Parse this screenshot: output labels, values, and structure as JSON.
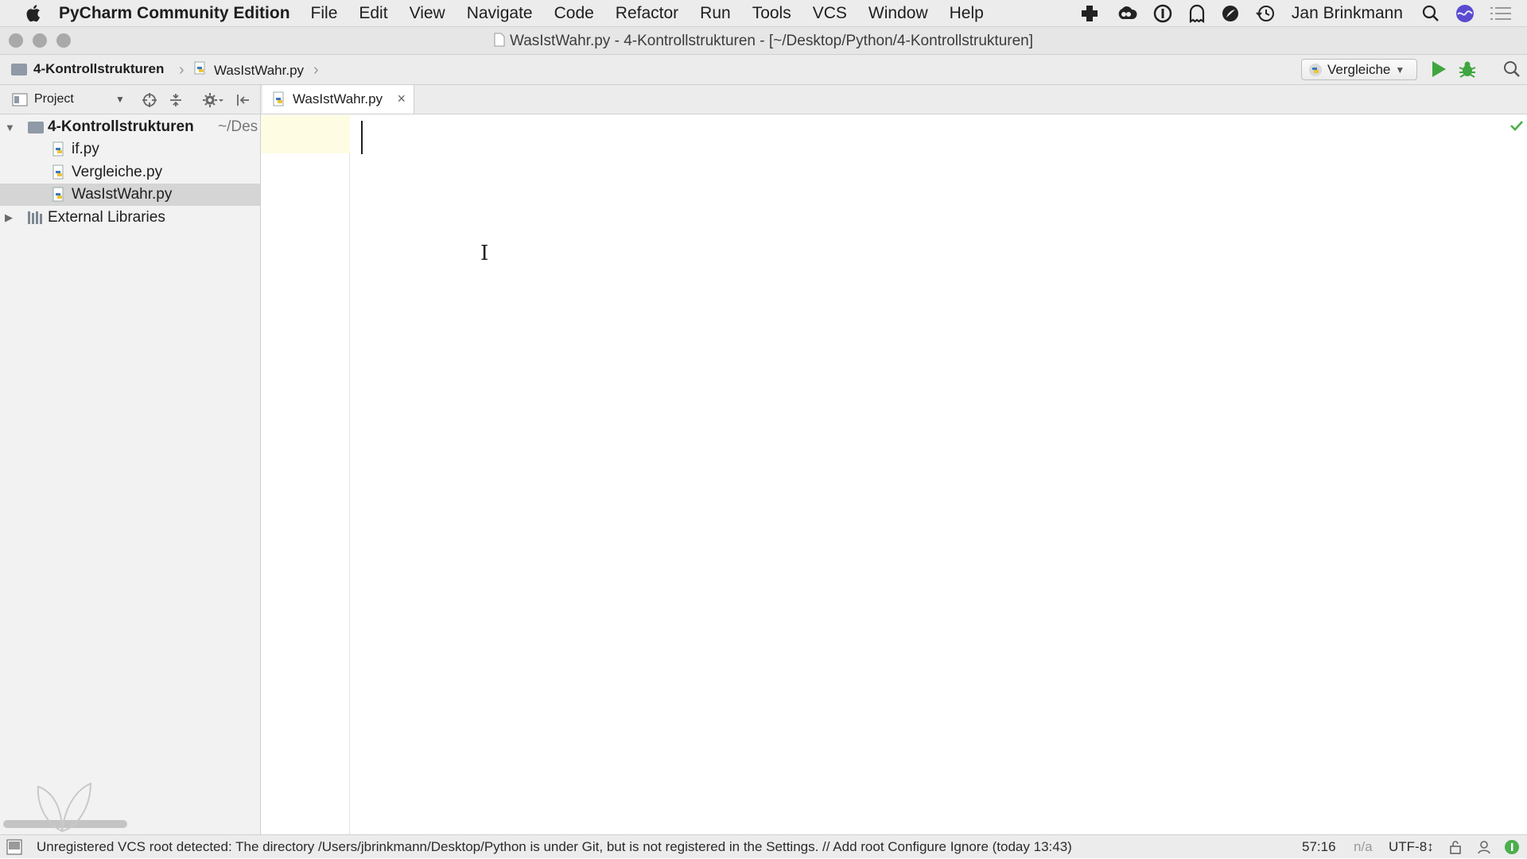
{
  "menubar": {
    "app_name": "PyCharm Community Edition",
    "menus": [
      "File",
      "Edit",
      "View",
      "Navigate",
      "Code",
      "Refactor",
      "Run",
      "Tools",
      "VCS",
      "Window",
      "Help"
    ],
    "user": "Jan Brinkmann"
  },
  "window": {
    "title": "WasIstWahr.py - 4-Kontrollstrukturen - [~/Desktop/Python/4-Kontrollstrukturen]"
  },
  "navbar": {
    "breadcrumbs": [
      "4-Kontrollstrukturen",
      "WasIstWahr.py"
    ],
    "run_config": "Vergleiche"
  },
  "project": {
    "header_label": "Project",
    "root": {
      "name": "4-Kontrollstrukturen",
      "path": "~/Des"
    },
    "files": [
      "if.py",
      "Vergleiche.py",
      "WasIstWahr.py"
    ],
    "selected_file": "WasIstWahr.py",
    "external": "External Libraries"
  },
  "editor": {
    "tab_label": "WasIstWahr.py",
    "content": ""
  },
  "statusbar": {
    "message": "Unregistered VCS root detected: The directory /Users/jbrinkmann/Desktop/Python is under Git, but is not registered in the Settings. // Add root  Configure  Ignore (today 13:43)",
    "position": "57:16",
    "line_sep": "n/a",
    "encoding": "UTF-8↕"
  },
  "colors": {
    "run_green": "#3fa63f",
    "menubar_bg": "#ececec",
    "selection": "#d5d5d5",
    "gutter_highlight": "#fefce3",
    "check_green": "#4cae4c"
  }
}
